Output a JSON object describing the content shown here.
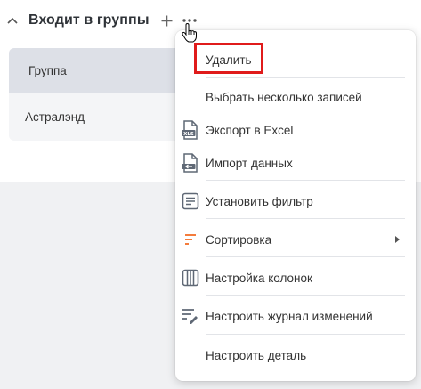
{
  "detail": {
    "title": "Входит в группы"
  },
  "grid": {
    "column_header": "Группа",
    "rows": [
      "Астралэнд"
    ]
  },
  "menu": {
    "items": [
      {
        "label": "Удалить",
        "icon": "none"
      },
      {
        "label": "Выбрать несколько записей",
        "icon": "none"
      },
      {
        "label": "Экспорт в Excel",
        "icon": "excel-export-icon"
      },
      {
        "label": "Импорт данных",
        "icon": "data-import-icon"
      },
      {
        "label": "Установить фильтр",
        "icon": "filter-icon"
      },
      {
        "label": "Сортировка",
        "icon": "sort-icon",
        "has_submenu": true
      },
      {
        "label": "Настройка колонок",
        "icon": "columns-icon"
      },
      {
        "label": "Настроить журнал изменений",
        "icon": "change-log-icon"
      },
      {
        "label": "Настроить деталь",
        "icon": "none"
      }
    ]
  },
  "colors": {
    "accent_highlight": "#e01b1b",
    "sort_icon": "#f26a21",
    "icon_gray": "#5f6875"
  }
}
